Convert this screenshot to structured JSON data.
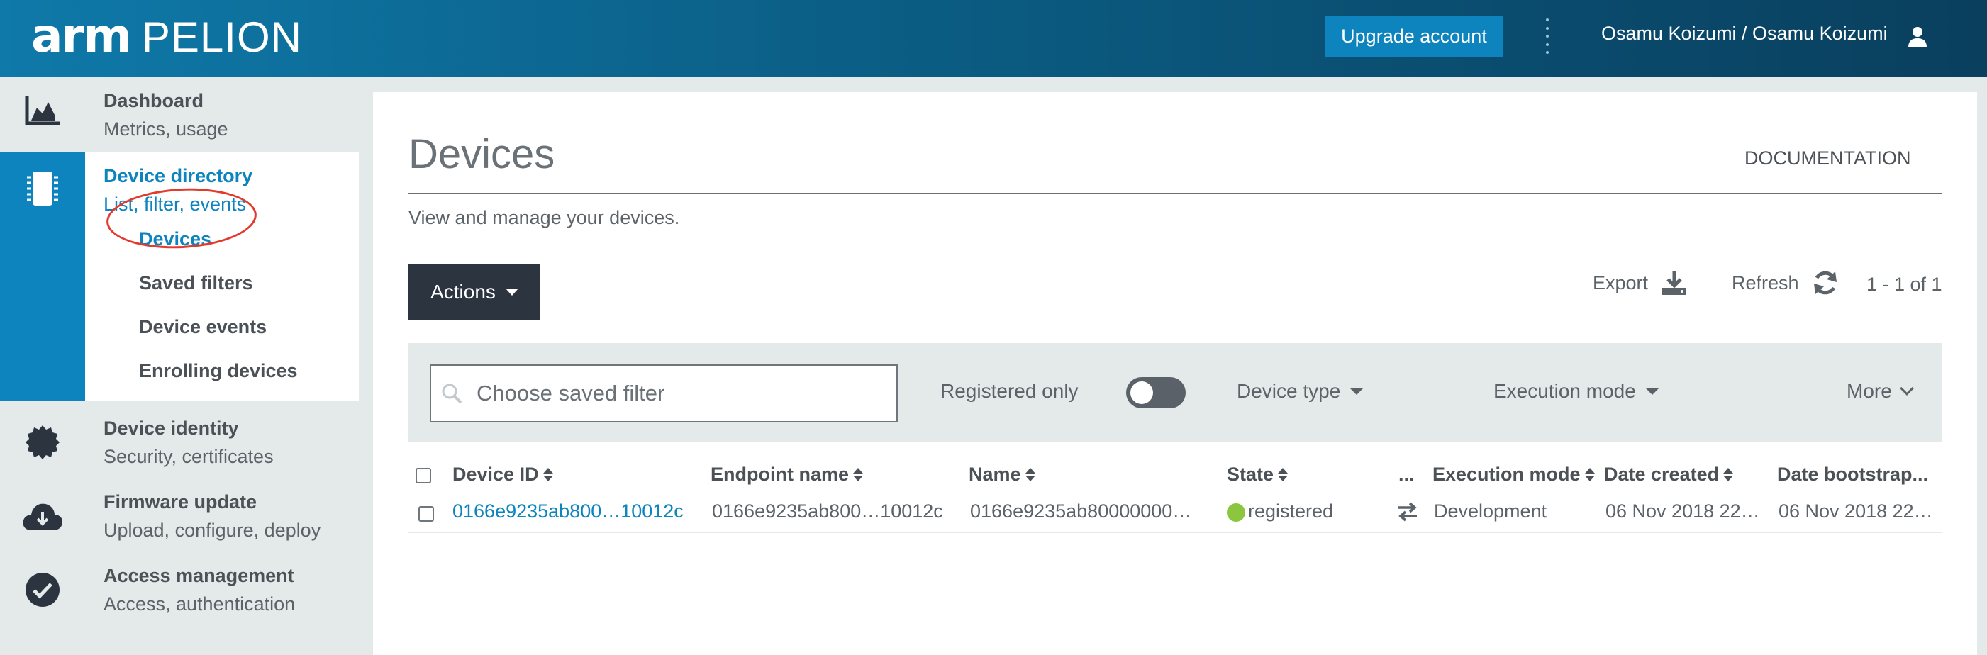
{
  "app": {
    "logo_arm": "arm",
    "logo_product": "PELION",
    "upgrade_label": "Upgrade account",
    "user": "Osamu Koizumi / Osamu Koizumi"
  },
  "sidebar": {
    "items": [
      {
        "title": "Dashboard",
        "subtitle": "Metrics, usage",
        "icon": "chart-icon"
      },
      {
        "title": "Device directory",
        "subtitle": "List, filter, events",
        "icon": "chip-icon"
      },
      {
        "title": "Device identity",
        "subtitle": "Security, certificates",
        "icon": "badge-icon"
      },
      {
        "title": "Firmware update",
        "subtitle": "Upload, configure, deploy",
        "icon": "cloud-download-icon"
      },
      {
        "title": "Access management",
        "subtitle": "Access, authentication",
        "icon": "check-circle-icon"
      }
    ],
    "subnav": [
      "Devices",
      "Saved filters",
      "Device events",
      "Enrolling devices"
    ]
  },
  "page": {
    "title": "Devices",
    "documentation": "DOCUMENTATION",
    "description": "View and manage your devices.",
    "actions": "Actions",
    "export": "Export",
    "refresh": "Refresh",
    "pager": "1 - 1 of 1"
  },
  "filters": {
    "saved_filter_placeholder": "Choose saved filter",
    "registered_only": "Registered only",
    "registered_only_on": false,
    "device_type": "Device type",
    "execution_mode": "Execution mode",
    "more": "More"
  },
  "table": {
    "columns": [
      "Device ID",
      "Endpoint name",
      "Name",
      "State",
      "...",
      "Execution mode",
      "Date created",
      "Date bootstrap..."
    ],
    "rows": [
      {
        "device_id": "0166e9235ab800…10012c",
        "endpoint_name": "0166e9235ab800…10012c",
        "name": "0166e9235ab80000000…",
        "state": "registered",
        "execution_mode": "Development",
        "date_created": "06 Nov 2018 22…",
        "date_bootstrapped": "06 Nov 2018 22…"
      }
    ]
  },
  "colors": {
    "brand_blue": "#0d84be",
    "state_registered": "#8cc63f",
    "actions_bg": "#2c3440"
  }
}
